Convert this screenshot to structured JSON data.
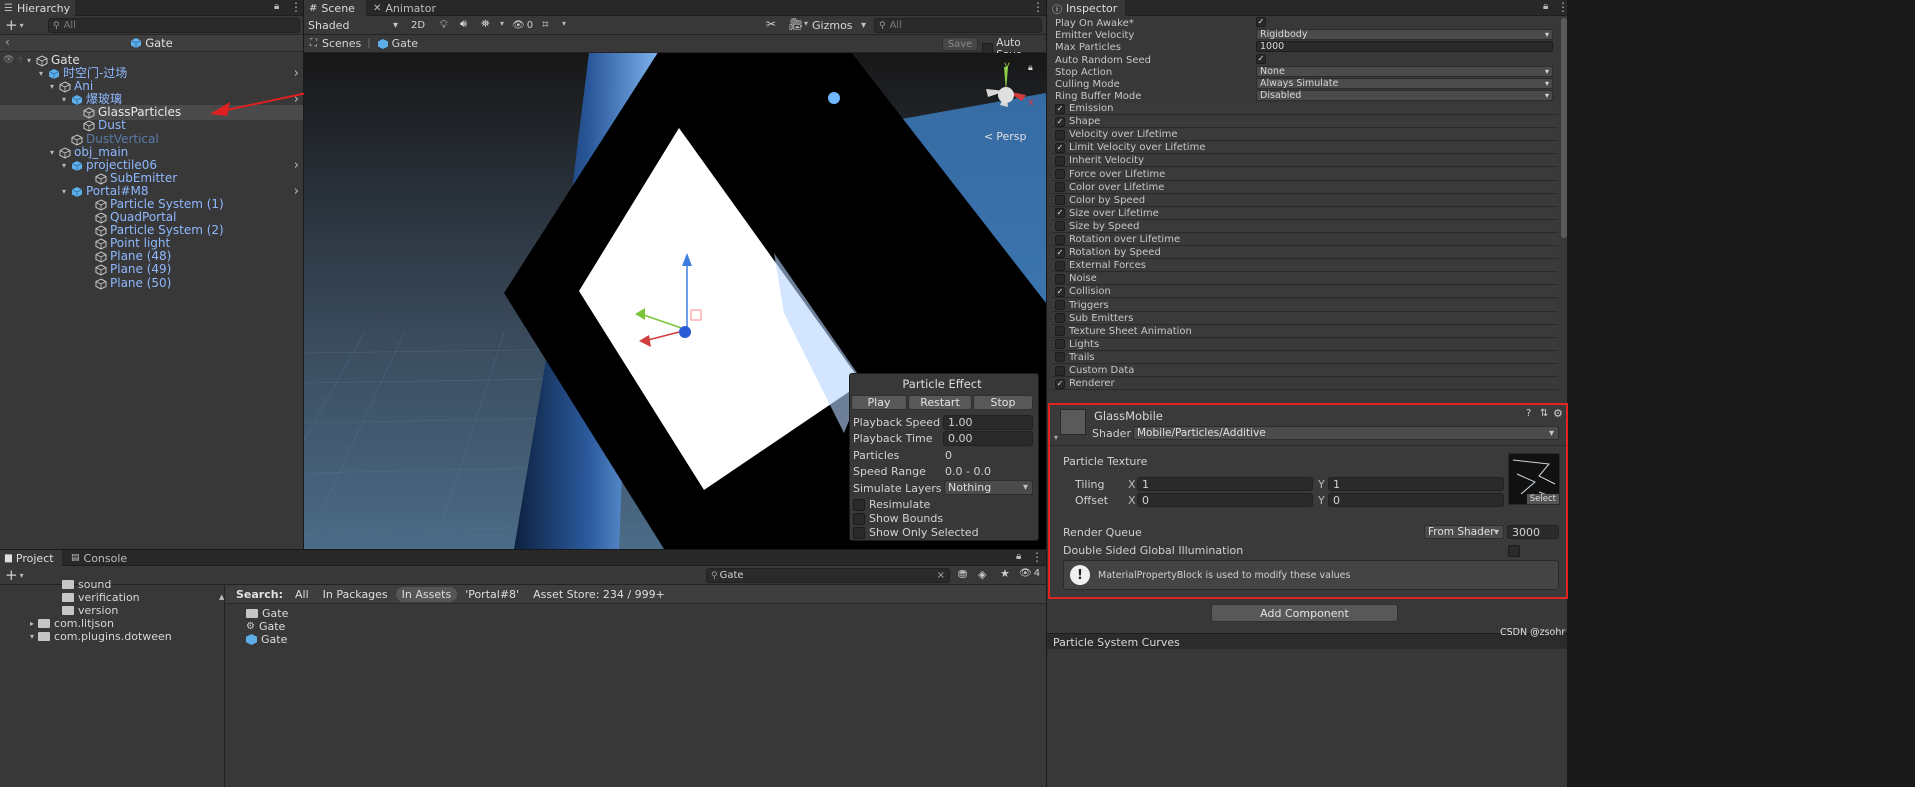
{
  "hierarchy": {
    "tab": "Hierarchy",
    "search_placeholder": "All",
    "breadcrumb": "Gate",
    "items": [
      {
        "label": "Gate"
      },
      {
        "label": "时空门-过场"
      },
      {
        "label": "Ani"
      },
      {
        "label": "爆玻璃"
      },
      {
        "label": "GlassParticles"
      },
      {
        "label": "Dust"
      },
      {
        "label": "DustVertical"
      },
      {
        "label": "obj_main"
      },
      {
        "label": "projectile06"
      },
      {
        "label": "SubEmitter"
      },
      {
        "label": "Portal#M8"
      },
      {
        "label": "Particle System (1)"
      },
      {
        "label": "QuadPortal"
      },
      {
        "label": "Particle System (2)"
      },
      {
        "label": "Point light"
      },
      {
        "label": "Plane (48)"
      },
      {
        "label": "Plane (49)"
      },
      {
        "label": "Plane (50)"
      }
    ]
  },
  "scene": {
    "tabs": [
      "Scene",
      "Animator"
    ],
    "shading": "Shaded",
    "mode_2d": "2D",
    "hidden_count": "0",
    "gizmos": "Gizmos",
    "search_placeholder": "All",
    "breadcrumb_root": "Scenes",
    "breadcrumb_item": "Gate",
    "save": "Save",
    "auto_save": "Auto Save",
    "persp": "Persp",
    "axis_x": "x",
    "axis_y": "y"
  },
  "particle_effect": {
    "title": "Particle Effect",
    "play": "Play",
    "restart": "Restart",
    "stop": "Stop",
    "playback_speed_label": "Playback Speed",
    "playback_speed": "1.00",
    "playback_time_label": "Playback Time",
    "playback_time": "0.00",
    "particles_label": "Particles",
    "particles": "0",
    "speed_range_label": "Speed Range",
    "speed_range": "0.0 - 0.0",
    "simulate_layers_label": "Simulate Layers",
    "simulate_layers": "Nothing",
    "resimulate": "Resimulate",
    "show_bounds": "Show Bounds",
    "show_only_selected": "Show Only Selected"
  },
  "inspector": {
    "tab": "Inspector",
    "props": [
      {
        "label": "Play On Awake*",
        "type": "check",
        "value": "✓"
      },
      {
        "label": "Emitter Velocity",
        "type": "dd",
        "value": "Rigidbody"
      },
      {
        "label": "Max Particles",
        "type": "tf",
        "value": "1000"
      },
      {
        "label": "Auto Random Seed",
        "type": "check",
        "value": "✓"
      },
      {
        "label": "Stop Action",
        "type": "dd",
        "value": "None"
      },
      {
        "label": "Culling Mode",
        "type": "dd",
        "value": "Always Simulate"
      },
      {
        "label": "Ring Buffer Mode",
        "type": "dd",
        "value": "Disabled"
      }
    ],
    "modules": [
      {
        "label": "Emission",
        "on": "✓"
      },
      {
        "label": "Shape",
        "on": "✓"
      },
      {
        "label": "Velocity over Lifetime",
        "on": ""
      },
      {
        "label": "Limit Velocity over Lifetime",
        "on": "✓"
      },
      {
        "label": "Inherit Velocity",
        "on": ""
      },
      {
        "label": "Force over Lifetime",
        "on": ""
      },
      {
        "label": "Color over Lifetime",
        "on": ""
      },
      {
        "label": "Color by Speed",
        "on": ""
      },
      {
        "label": "Size over Lifetime",
        "on": "✓"
      },
      {
        "label": "Size by Speed",
        "on": ""
      },
      {
        "label": "Rotation over Lifetime",
        "on": ""
      },
      {
        "label": "Rotation by Speed",
        "on": "✓"
      },
      {
        "label": "External Forces",
        "on": ""
      },
      {
        "label": "Noise",
        "on": ""
      },
      {
        "label": "Collision",
        "on": "✓"
      },
      {
        "label": "Triggers",
        "on": ""
      },
      {
        "label": "Sub Emitters",
        "on": ""
      },
      {
        "label": "Texture Sheet Animation",
        "on": ""
      },
      {
        "label": "Lights",
        "on": ""
      },
      {
        "label": "Trails",
        "on": ""
      },
      {
        "label": "Custom Data",
        "on": ""
      },
      {
        "label": "Renderer",
        "on": "✓"
      }
    ],
    "material": {
      "name": "GlassMobile",
      "shader_label": "Shader",
      "shader": "Mobile/Particles/Additive",
      "texture_label": "Particle Texture",
      "tiling_label": "Tiling",
      "offset_label": "Offset",
      "x_label": "X",
      "y_label": "Y",
      "tiling_x": "1",
      "tiling_y": "1",
      "offset_x": "0",
      "offset_y": "0",
      "select": "Select",
      "render_queue_label": "Render Queue",
      "render_queue_mode": "From Shader",
      "render_queue": "3000",
      "double_sided_label": "Double Sided Global Illumination",
      "info": "MaterialPropertyBlock is used to modify these values"
    },
    "add_component": "Add Component",
    "next_section": "Particle System Curves"
  },
  "project": {
    "tabs": [
      "Project",
      "Console"
    ],
    "search_value": "Gate",
    "hidden_count": "4",
    "tree": [
      "sound",
      "verification",
      "version",
      "com.litjson",
      "com.plugins.dotween"
    ],
    "search_label": "Search:",
    "filters": [
      "All",
      "In Packages",
      "In Assets",
      "'Portal#8'",
      "Asset Store: 234 / 999+"
    ],
    "results": [
      "Gate",
      "Gate",
      "Gate"
    ]
  },
  "watermark": "CSDN @zsohr"
}
